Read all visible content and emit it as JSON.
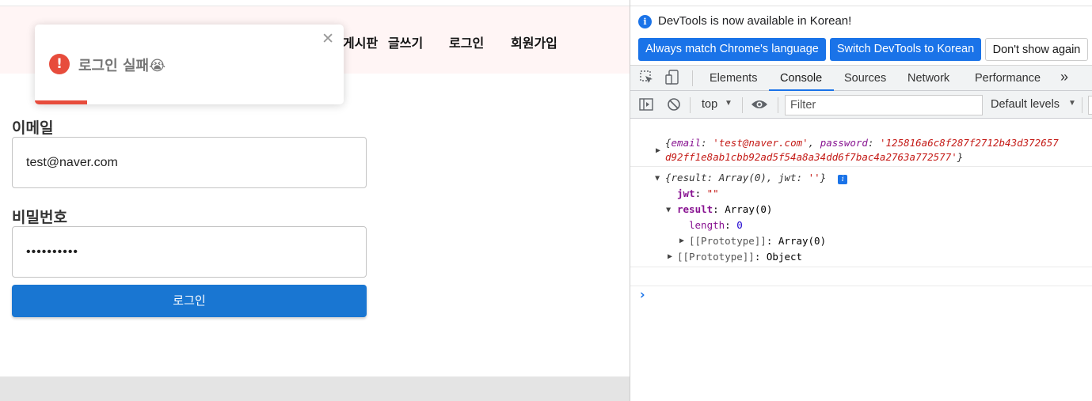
{
  "nav": {
    "board": "게시판",
    "write": "글쓰기",
    "login": "로그인",
    "signup": "회원가입"
  },
  "toast": {
    "message": "로그인 실패😭",
    "close": "✕",
    "icon": "!",
    "progress_fraction": 0.17,
    "accent": "#e74c3c"
  },
  "form": {
    "email_label": "이메일",
    "email_value": "test@naver.com",
    "password_label": "비밀번호",
    "password_value": "••••••••••",
    "submit_label": "로그인",
    "submit_color": "#1976d2"
  },
  "devtools": {
    "info_text": "DevTools is now available in Korean!",
    "info_icon": "i",
    "btn_match": "Always match Chrome's language",
    "btn_switch": "Switch DevTools to Korean",
    "btn_dismiss": "Don't show again",
    "tabs": [
      "Elements",
      "Console",
      "Sources",
      "Network",
      "Performance"
    ],
    "more_tabs": "»",
    "context": "top",
    "filter_placeholder": "Filter",
    "levels": "Default levels",
    "accent": "#1a73e8",
    "console": {
      "obj1_open": "{",
      "obj1_email_key": "email",
      "obj1_email_val": "'test@naver.com'",
      "obj1_pw_key": "password",
      "obj1_pw_val1": "'125816a6c8f287f2712b43d372657",
      "obj1_pw_val2": "d92ff1e8ab1cbb92ad5f54a8a34dd6f7bac4a2763a772577'",
      "obj1_close": "}",
      "obj2_summary_pre": "{result: Array(0), jwt: ",
      "obj2_summary_str": "''",
      "obj2_summary_post": "}",
      "badge": "i",
      "jwt_key": "jwt",
      "jwt_val": "\"\"",
      "result_key": "result",
      "result_val": "Array(0)",
      "length_key": "length",
      "length_val": "0",
      "proto_array": "[[Prototype]]",
      "proto_array_val": "Array(0)",
      "proto_obj": "[[Prototype]]",
      "proto_obj_val": "Object",
      "prompt": "›"
    }
  }
}
